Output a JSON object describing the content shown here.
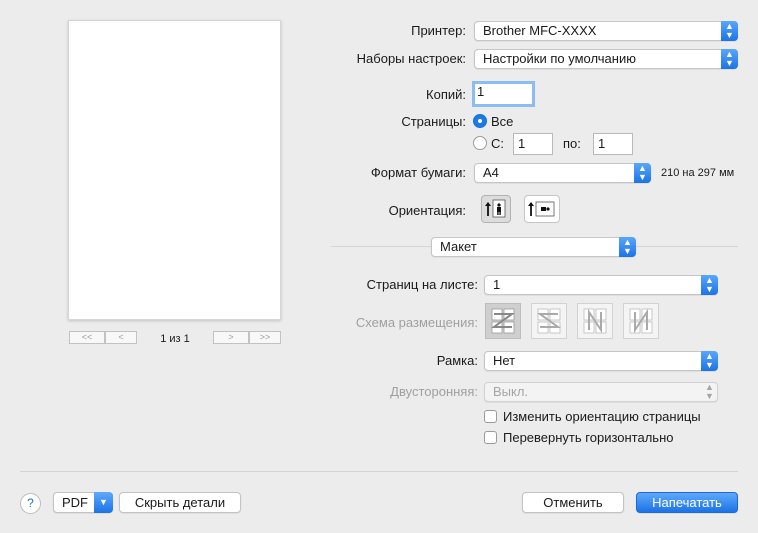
{
  "preview": {
    "nav_first": "<<",
    "nav_prev": "<",
    "nav_next": ">",
    "nav_last": ">>",
    "page_count": "1 из 1"
  },
  "printer": {
    "label": "Принтер:",
    "value": "Brother MFC-XXXX"
  },
  "presets": {
    "label": "Наборы настроек:",
    "value": "Настройки по умолчанию"
  },
  "copies": {
    "label": "Копий:",
    "value": "1"
  },
  "pages": {
    "label": "Страницы:",
    "all_label": "Все",
    "from_label": "С:",
    "from_value": "1",
    "to_label": "по:",
    "to_value": "1"
  },
  "paper": {
    "label": "Формат бумаги:",
    "value": "A4",
    "size_text": "210 на 297 мм"
  },
  "orientation": {
    "label": "Ориентация:"
  },
  "section": {
    "value": "Макет"
  },
  "layout": {
    "pages_per_sheet_label": "Страниц на листе:",
    "pages_per_sheet_value": "1",
    "direction_label": "Схема размещения:",
    "border_label": "Рамка:",
    "border_value": "Нет",
    "two_sided_label": "Двусторонняя:",
    "two_sided_value": "Выкл.",
    "reverse_label": "Изменить ориентацию страницы",
    "flip_label": "Перевернуть горизонтально"
  },
  "bottom": {
    "help": "?",
    "pdf": "PDF",
    "hide_details": "Скрыть детали",
    "cancel": "Отменить",
    "print": "Напечатать"
  },
  "colors": {
    "accent": "#1b73e6",
    "background": "#ececec"
  },
  "icons": {
    "popup_arrows": "updown-chevron-icon",
    "pdf_arrow": "chevron-down-icon",
    "portrait": "portrait-orientation-icon",
    "landscape": "landscape-orientation-icon",
    "layout_dirs": [
      "layout-z-icon",
      "layout-reverse-z-icon",
      "layout-n-reverse-icon",
      "layout-n-icon"
    ]
  },
  "glyphs": {
    "updown": "▲▼",
    "down": "▼"
  }
}
